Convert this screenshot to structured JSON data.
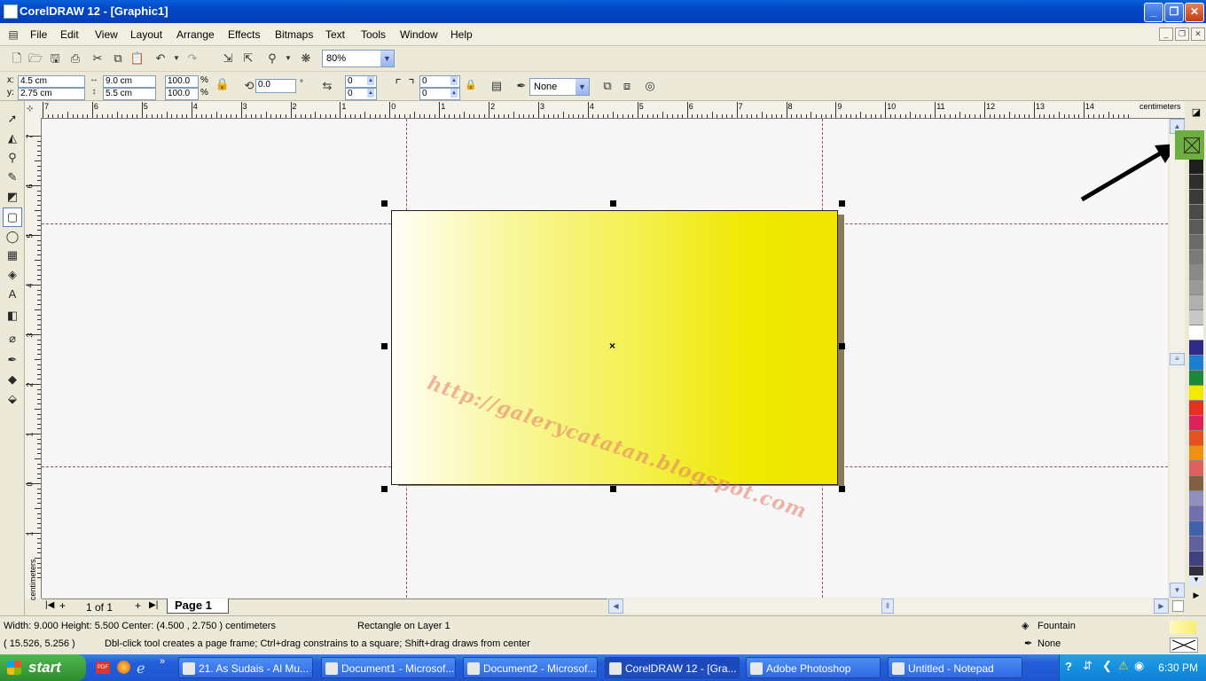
{
  "window": {
    "title": "CorelDRAW 12 - [Graphic1]"
  },
  "menu": [
    "File",
    "Edit",
    "View",
    "Layout",
    "Arrange",
    "Effects",
    "Bitmaps",
    "Text",
    "Tools",
    "Window",
    "Help"
  ],
  "toolbar": {
    "zoom": "80%"
  },
  "property_bar": {
    "x_label": "x:",
    "x_value": "4.5 cm",
    "y_label": "y:",
    "y_value": "2.75 cm",
    "width_value": "9.0 cm",
    "height_value": "5.5 cm",
    "scale_w": "100.0",
    "scale_h": "100.0",
    "percent": "%",
    "rotation": "0.0",
    "degree": "°",
    "corner_1": "0",
    "corner_2": "0",
    "corner_3": "0",
    "corner_4": "0",
    "outline_width": "None"
  },
  "ruler": {
    "units": "centimeters",
    "h_labels": [
      "7",
      "6",
      "5",
      "4",
      "3",
      "2",
      "1",
      "0",
      "1",
      "2",
      "3",
      "4",
      "5",
      "6",
      "7",
      "8",
      "9",
      "10",
      "11",
      "12",
      "13",
      "14"
    ],
    "v_labels": [
      "7",
      "6",
      "5",
      "4",
      "3",
      "2",
      "1",
      "0",
      "1"
    ]
  },
  "canvas": {
    "watermark": "http://galerycatatan.blogspot.com"
  },
  "page_nav": {
    "count": "1 of 1",
    "tab": "Page 1"
  },
  "palette": {
    "colors": [
      "#1e1e1e",
      "#2e2e2e",
      "#3a3a3a",
      "#4a4a4a",
      "#5a5a5a",
      "#6a6a6a",
      "#7a7a7a",
      "#8a8a8a",
      "#9a9a9a",
      "#b0b0b0",
      "#c8c8c8",
      "#ffffff",
      "#2e2a8a",
      "#1a7fd0",
      "#1a8a3a",
      "#f2ea00",
      "#e83020",
      "#e0205a",
      "#e85020",
      "#f09010",
      "#e06060",
      "#806040",
      "#9090c0",
      "#7070b0",
      "#4060b0",
      "#6060a0",
      "#404080",
      "#303040"
    ]
  },
  "status": {
    "dimensions": "Width: 9.000  Height: 5.500  Center: (4.500 , 2.750 )  centimeters",
    "object": "Rectangle on Layer 1",
    "coords": "( 15.526, 5.256 )",
    "hint": "Dbl-click tool creates a page frame; Ctrl+drag constrains to a square; Shift+drag draws from center",
    "fill": "Fountain",
    "outline": "None"
  },
  "taskbar": {
    "start": "start",
    "tasks": [
      "21. As Sudais - Al Mu...",
      "Document1 - Microsof...",
      "Document2 - Microsof...",
      "CorelDRAW 12 - [Gra...",
      "Adobe Photoshop",
      "Untitled - Notepad"
    ],
    "clock": "6:30 PM"
  }
}
